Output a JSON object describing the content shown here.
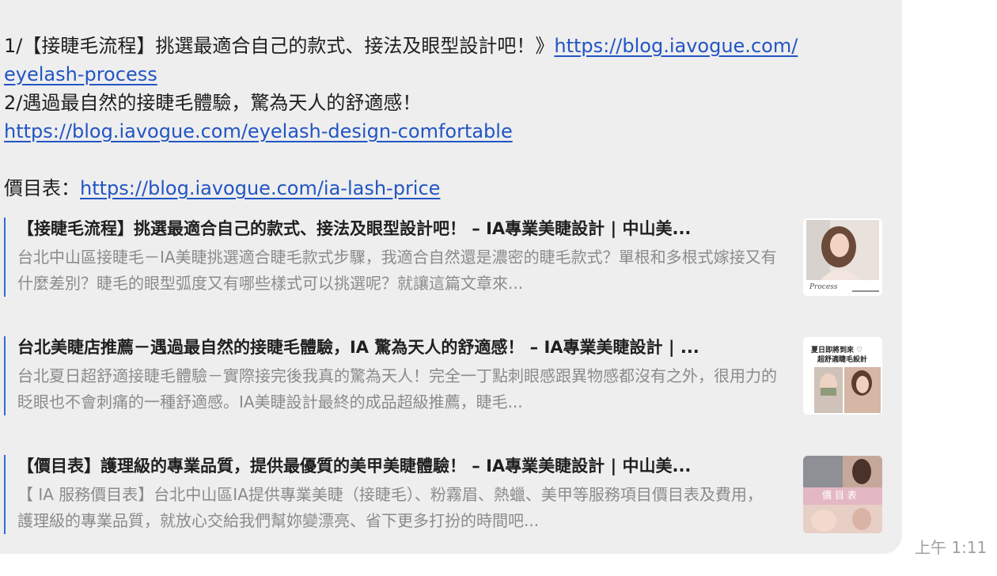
{
  "message": {
    "line1_text": "1/【接睫毛流程】挑選最適合自己的款式、接法及眼型設計吧！》",
    "line1_link_part1": "https://blog.iavogue.com/",
    "line1_link_part2": "eyelash-process",
    "line2_text": "2/遇過最自然的接睫毛體驗，驚為天人的舒適感！",
    "line2_link": "https://blog.iavogue.com/eyelash-design-comfortable",
    "price_label": "價目表：",
    "price_link": "https://blog.iavogue.com/ia-lash-price"
  },
  "previews": [
    {
      "title": "【接睫毛流程】挑選最適合自己的款式、接法及眼型設計吧！ – IA專業美睫設計 | 中山美...",
      "description": "台北中山區接睫毛－IA美睫挑選適合睫毛款式步驟，我適合自然還是濃密的睫毛款式？單根和多根式嫁接又有什麼差別？睫毛的眼型弧度又有哪些樣式可以挑選呢？就讓這篇文章來...",
      "thumb_caption": "Process"
    },
    {
      "title": "台北美睫店推薦－遇過最自然的接睫毛體驗，IA 驚為天人的舒適感！ – IA專業美睫設計 | ...",
      "description": "台北夏日超舒適接睫毛體驗－實際接完後我真的驚為天人！完全一丁點刺眼感跟異物感都沒有之外，很用力的眨眼也不會刺痛的一種舒適感。IA美睫設計最終的成品超級推薦，睫毛...",
      "thumb_line1": "夏日即將到來 ♡",
      "thumb_line2": "超舒適睫毛設計"
    },
    {
      "title": "【價目表】護理級的專業品質，提供最優質的美甲美睫體驗！ – IA專業美睫設計 | 中山美...",
      "description": "【 IA 服務價目表】台北中山區IA提供專業美睫（接睫毛）、粉霧眉、熱蠟、美甲等服務項目價目表及費用，護理級的專業品質，就放心交給我們幫妳變漂亮、省下更多打扮的時間吧...",
      "thumb_caption": "價 目 表"
    }
  ],
  "timestamp": "上午 1:11"
}
